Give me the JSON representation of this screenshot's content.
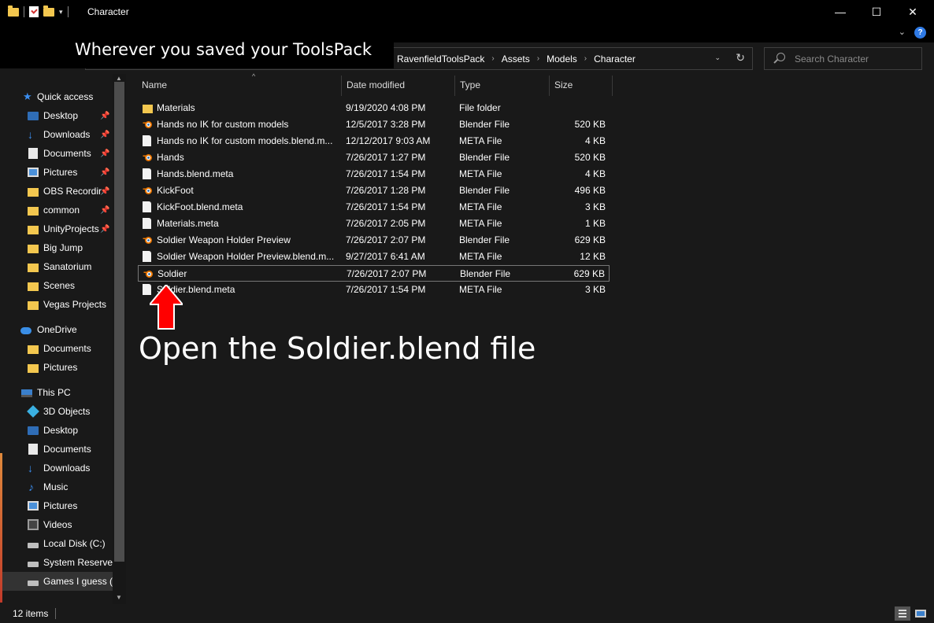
{
  "window": {
    "title": "Character",
    "minimize_glyph": "—",
    "maximize_glyph": "☐",
    "close_glyph": "✕",
    "dropdown_glyph": "▾"
  },
  "ribbon": {
    "expand_glyph": "⌄",
    "help_glyph": "?"
  },
  "address": {
    "crumbs": [
      "RavenfieldToolsPack",
      "Assets",
      "Models",
      "Character"
    ],
    "separator": "›",
    "dropdown_glyph": "⌄",
    "refresh_glyph": "↻"
  },
  "search": {
    "placeholder": "Search Character"
  },
  "annotations": {
    "top": "Wherever you saved your ToolsPack",
    "bottom": "Open the Soldier.blend file",
    "arrow_color": "#ff0000"
  },
  "sidebar": {
    "items": [
      {
        "label": "Quick access",
        "icon": "star-icon"
      },
      {
        "label": "Desktop",
        "icon": "desktop-icon",
        "pinned": true
      },
      {
        "label": "Downloads",
        "icon": "downloads-icon",
        "pinned": true
      },
      {
        "label": "Documents",
        "icon": "documents-icon",
        "pinned": true
      },
      {
        "label": "Pictures",
        "icon": "pictures-icon",
        "pinned": true
      },
      {
        "label": "OBS Recordir",
        "icon": "folder-icon",
        "pinned": true
      },
      {
        "label": "common",
        "icon": "folder-icon",
        "pinned": true
      },
      {
        "label": "UnityProjects",
        "icon": "folder-icon",
        "pinned": true
      },
      {
        "label": "Big Jump",
        "icon": "folder-icon"
      },
      {
        "label": "Sanatorium",
        "icon": "folder-icon"
      },
      {
        "label": "Scenes",
        "icon": "folder-icon"
      },
      {
        "label": "Vegas Projects",
        "icon": "folder-icon"
      },
      {
        "label": "OneDrive",
        "icon": "cloud-icon"
      },
      {
        "label": "Documents",
        "icon": "folder-icon"
      },
      {
        "label": "Pictures",
        "icon": "folder-icon"
      },
      {
        "label": "This PC",
        "icon": "pc-icon"
      },
      {
        "label": "3D Objects",
        "icon": "cube-icon"
      },
      {
        "label": "Desktop",
        "icon": "desktop-icon"
      },
      {
        "label": "Documents",
        "icon": "documents-icon"
      },
      {
        "label": "Downloads",
        "icon": "downloads-icon"
      },
      {
        "label": "Music",
        "icon": "music-icon"
      },
      {
        "label": "Pictures",
        "icon": "pictures-icon"
      },
      {
        "label": "Videos",
        "icon": "videos-icon"
      },
      {
        "label": "Local Disk (C:)",
        "icon": "disk-icon"
      },
      {
        "label": "System Reservec",
        "icon": "disk-icon"
      },
      {
        "label": "Games I guess (E",
        "icon": "disk-icon",
        "selected": true
      }
    ],
    "pin_glyph": "📌",
    "scroll_up": "▲",
    "scroll_down": "▼"
  },
  "columns": {
    "name": "Name",
    "date": "Date modified",
    "type": "Type",
    "size": "Size",
    "sort_glyph": "^"
  },
  "files": [
    {
      "name": "Materials",
      "date": "9/19/2020 4:08 PM",
      "type": "File folder",
      "size": "",
      "icon": "folder-icon"
    },
    {
      "name": "Hands no IK for custom models",
      "date": "12/5/2017 3:28 PM",
      "type": "Blender File",
      "size": "520 KB",
      "icon": "blender-icon"
    },
    {
      "name": "Hands no IK for custom models.blend.m...",
      "date": "12/12/2017 9:03 AM",
      "type": "META File",
      "size": "4 KB",
      "icon": "file-icon"
    },
    {
      "name": "Hands",
      "date": "7/26/2017 1:27 PM",
      "type": "Blender File",
      "size": "520 KB",
      "icon": "blender-icon"
    },
    {
      "name": "Hands.blend.meta",
      "date": "7/26/2017 1:54 PM",
      "type": "META File",
      "size": "4 KB",
      "icon": "file-icon"
    },
    {
      "name": "KickFoot",
      "date": "7/26/2017 1:28 PM",
      "type": "Blender File",
      "size": "496 KB",
      "icon": "blender-icon"
    },
    {
      "name": "KickFoot.blend.meta",
      "date": "7/26/2017 1:54 PM",
      "type": "META File",
      "size": "3 KB",
      "icon": "file-icon"
    },
    {
      "name": "Materials.meta",
      "date": "7/26/2017 2:05 PM",
      "type": "META File",
      "size": "1 KB",
      "icon": "file-icon"
    },
    {
      "name": "Soldier Weapon Holder Preview",
      "date": "7/26/2017 2:07 PM",
      "type": "Blender File",
      "size": "629 KB",
      "icon": "blender-icon"
    },
    {
      "name": "Soldier Weapon Holder Preview.blend.m...",
      "date": "9/27/2017 6:41 AM",
      "type": "META File",
      "size": "12 KB",
      "icon": "file-icon"
    },
    {
      "name": "Soldier",
      "date": "7/26/2017 2:07 PM",
      "type": "Blender File",
      "size": "629 KB",
      "icon": "blender-icon",
      "selected": true
    },
    {
      "name": "Soldier.blend.meta",
      "date": "7/26/2017 1:54 PM",
      "type": "META File",
      "size": "3 KB",
      "icon": "file-icon"
    }
  ],
  "status": {
    "count": "12 items"
  },
  "colors": {
    "background": "#191919",
    "chrome": "#000000",
    "folder": "#f3c74f",
    "accent": "#3b8ef0",
    "blender_orange": "#ea7600"
  }
}
